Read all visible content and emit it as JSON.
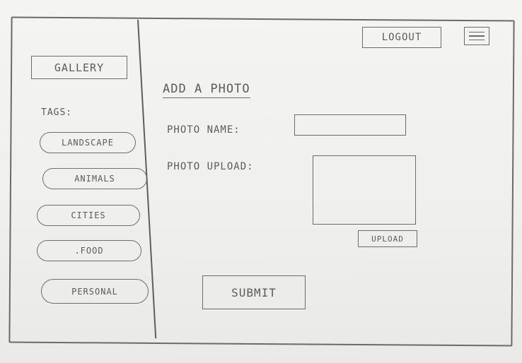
{
  "sidebar": {
    "logo": "GALLERY",
    "tags_label": "TAGS:",
    "tags": [
      {
        "label": "LANDSCAPE"
      },
      {
        "label": "ANIMALS"
      },
      {
        "label": "CITIES"
      },
      {
        "label": ".FOOD"
      },
      {
        "label": "PERSONAL"
      }
    ]
  },
  "header": {
    "logout_label": "LOGOUT",
    "menu_icon": "hamburger-menu-icon"
  },
  "main": {
    "heading": "ADD A PHOTO",
    "photo_name_label": "PHOTO NAME:",
    "photo_upload_label": "PHOTO UPLOAD:",
    "upload_button_label": "UPLOAD",
    "submit_label": "SUBMIT"
  }
}
